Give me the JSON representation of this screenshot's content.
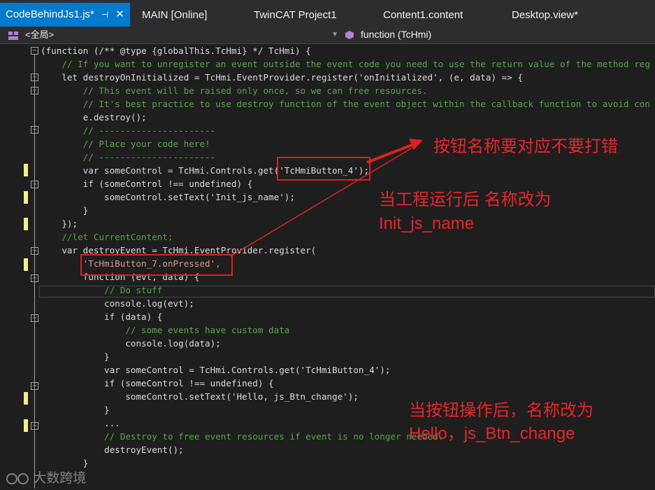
{
  "tabs": [
    {
      "label": "CodeBehindJs1.js*",
      "active": true
    },
    {
      "label": "MAIN [Online]"
    },
    {
      "label": "TwinCAT Project1"
    },
    {
      "label": "Content1.content"
    },
    {
      "label": "Desktop.view*"
    }
  ],
  "nav": {
    "scope": "<全局>",
    "member": "function (TcHmi)"
  },
  "code_lines": [
    "(function (/** @type {globalThis.TcHmi} */ TcHmi) {",
    "    // If you want to unregister an event outside the event code you need to use the return value of the method reg",
    "    let destroyOnInitialized = TcHmi.EventProvider.register('onInitialized', (e, data) => {",
    "        // This event will be raised only once, so we can free resources.",
    "        // It's best practice to use destroy function of the event object within the callback function to avoid con",
    "        e.destroy();",
    "        // ----------------------",
    "        // Place your code here!",
    "        // ----------------------",
    "        var someControl = TcHmi.Controls.get('TcHmiButton_4');",
    "        if (someControl !== undefined) {",
    "            someControl.setText('Init_js_name');",
    "        }",
    "    });",
    "    //let CurrentContent;",
    "    var destroyEvent = TcHmi.EventProvider.register(",
    "        'TcHmiButton_7.onPressed',",
    "        function (evt, data) {",
    "            // Do stuff",
    "            console.log(evt);",
    "            if (data) {",
    "                // some events have custom data",
    "                console.log(data);",
    "            }",
    "            var someControl = TcHmi.Controls.get('TcHmiButton_4');",
    "            if (someControl !== undefined) {",
    "                someControl.setText('Hello, js_Btn_change');",
    "            }",
    "            ...",
    "            // Destroy to free event resources if event is no longer needed.",
    "            destroyEvent();",
    "        }"
  ],
  "annotations": {
    "a1": "按钮名称要对应不要打错",
    "a2_line1": "当工程运行后 名称改为",
    "a2_line2": "Init_js_name",
    "a3_line1": "当按钮操作后，名称改为",
    "a3_line2": "Hello，js_Btn_change"
  },
  "watermark": "大数跨境",
  "colors": {
    "keyword": "#569cd6",
    "comment": "#57a64a",
    "string": "#d69d85",
    "text": "#dcdcdc",
    "accent": "#007acc",
    "annotation": "#e8262a"
  }
}
